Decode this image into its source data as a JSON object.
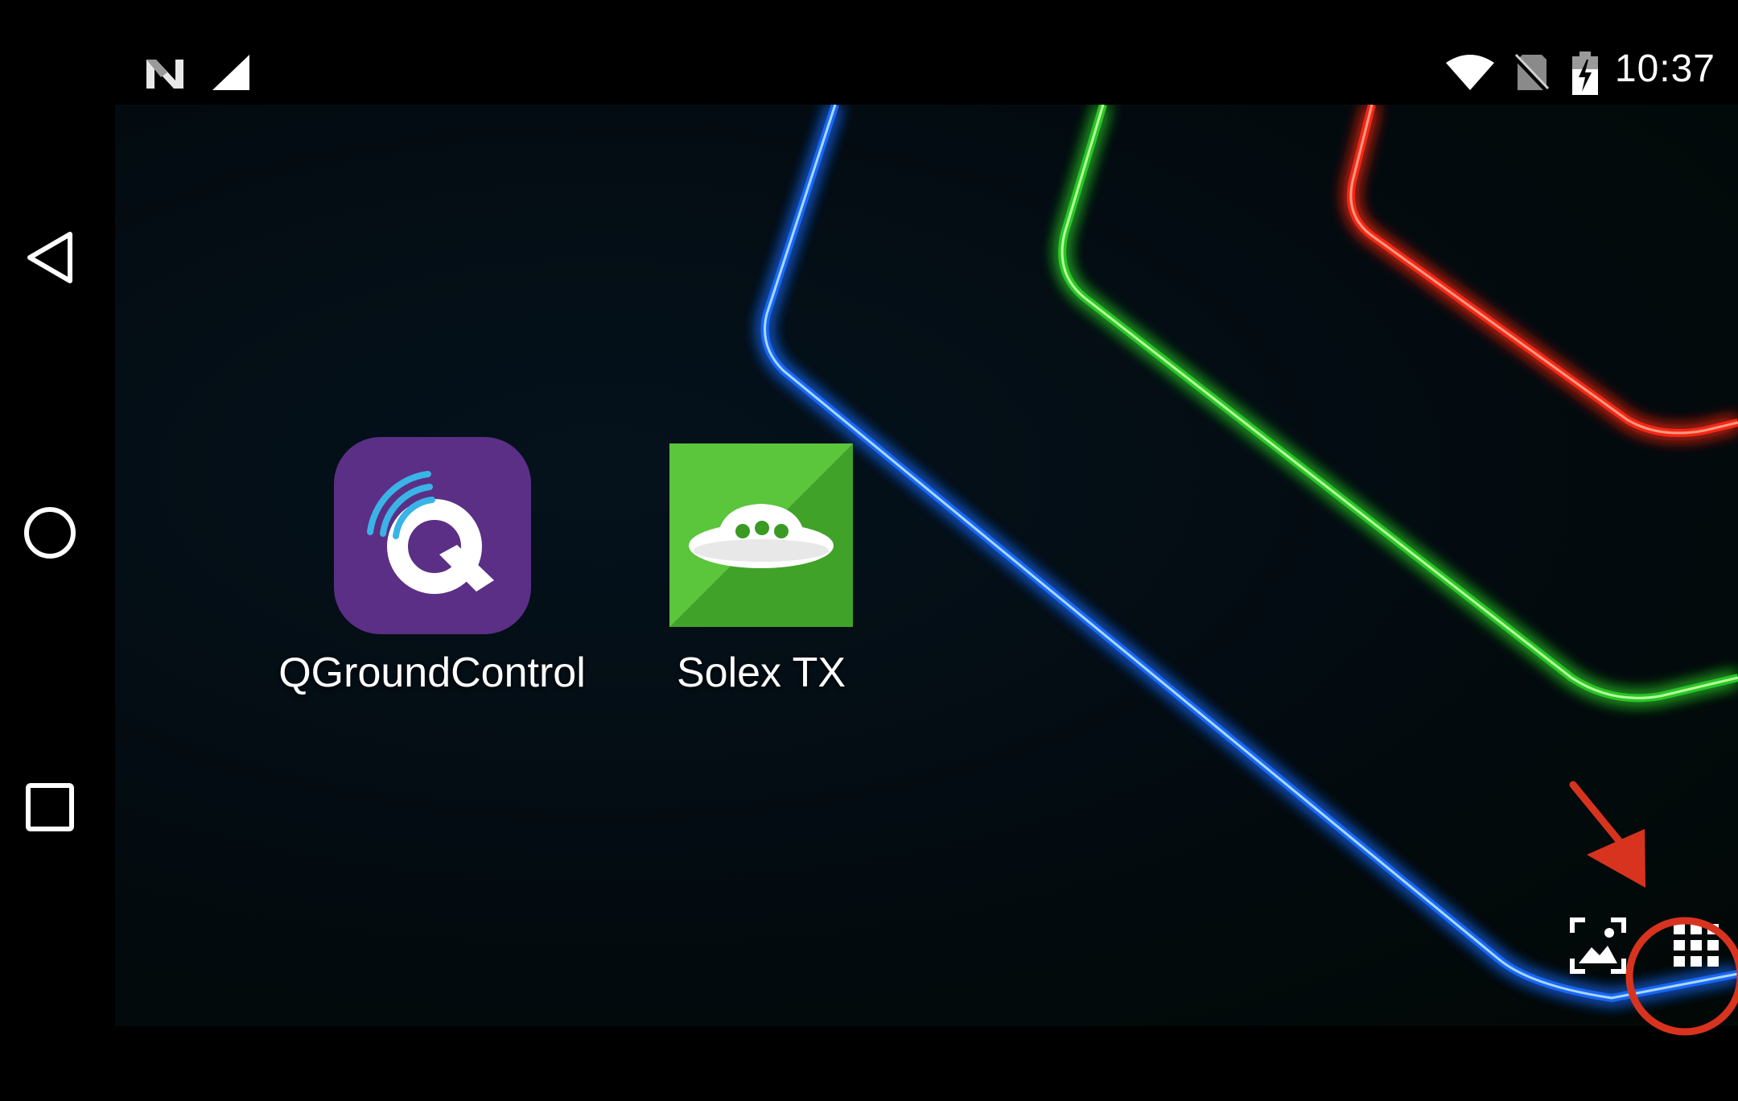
{
  "status_bar": {
    "time": "10:37",
    "left_icons": [
      "notification-n-icon",
      "cell-signal-icon"
    ],
    "right_icons": [
      "wifi-icon",
      "no-sim-icon",
      "battery-charging-icon"
    ]
  },
  "nav_bar": {
    "buttons": [
      "back-icon",
      "home-icon",
      "recents-icon"
    ]
  },
  "home_screen": {
    "apps": [
      {
        "label": "QGroundControl",
        "icon": "qgroundcontrol-icon",
        "color": "#5b2f86"
      },
      {
        "label": "Solex TX",
        "icon": "solex-ufo-icon",
        "color": "#5bc53c"
      }
    ],
    "corner_buttons": [
      "wallpaper-picker-icon",
      "app-drawer-icon"
    ]
  },
  "annotation": {
    "color": "#d8331f",
    "target": "app-drawer-icon"
  }
}
